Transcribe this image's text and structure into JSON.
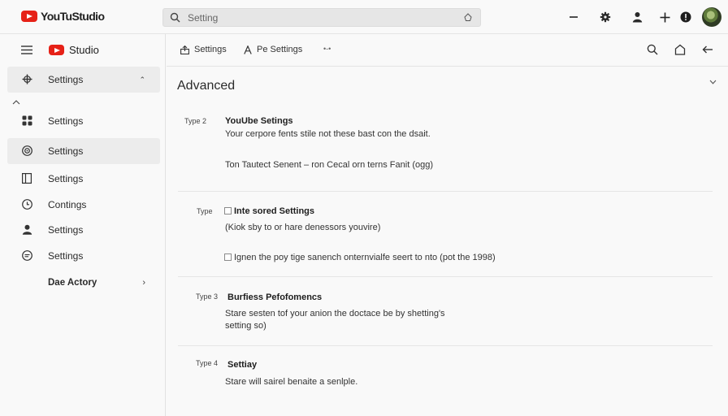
{
  "app": {
    "logo_text": "YouTuStudio",
    "brand_color": "#e62117"
  },
  "search": {
    "placeholder": "Setting"
  },
  "sidebar": {
    "brand": "Studio",
    "items": [
      {
        "label": "Settings",
        "icon": "settings-gear-icon",
        "active": true
      },
      {
        "label": "Settings",
        "icon": "grid-icon"
      },
      {
        "label": "Settings",
        "icon": "target-icon",
        "active": true
      },
      {
        "label": "Settings",
        "icon": "book-icon"
      },
      {
        "label": "Contings",
        "icon": "clock-icon"
      },
      {
        "label": "Settings",
        "icon": "person-icon"
      },
      {
        "label": "Settings",
        "icon": "feedback-icon"
      },
      {
        "label": "Dae Actory"
      }
    ]
  },
  "subbar": {
    "crumbs": [
      {
        "label": "Settings",
        "icon": "upload-icon"
      },
      {
        "label": "Pe Settings",
        "icon": "font-icon"
      }
    ],
    "more": "•-•"
  },
  "main": {
    "title": "Advanced",
    "sections": [
      {
        "type": "Type 2",
        "title": "YouUbe Setings",
        "lines": [
          "Your cerpore fents stile not these bast con the dsait.",
          "Ton Tautect Senent – ron Cecal orn terns Fanit (ogg)"
        ]
      },
      {
        "type": "Type",
        "title": "Inte sored Settings",
        "lines": [
          "(Kiok sby to or hare denessors youvire)",
          "Ignen the poy tige sanench onternvialfe seert to nto (pot the 1998)"
        ]
      },
      {
        "type": "Type 3",
        "title": "Burfiess Pefofomencs",
        "lines": [
          "Stare sesten tof your anion the doctace be by shetting's",
          "setting so)"
        ]
      },
      {
        "type": "Type 4",
        "title": "Settiay",
        "lines": [
          "Stare will sairel benaite a senlple."
        ]
      }
    ]
  }
}
